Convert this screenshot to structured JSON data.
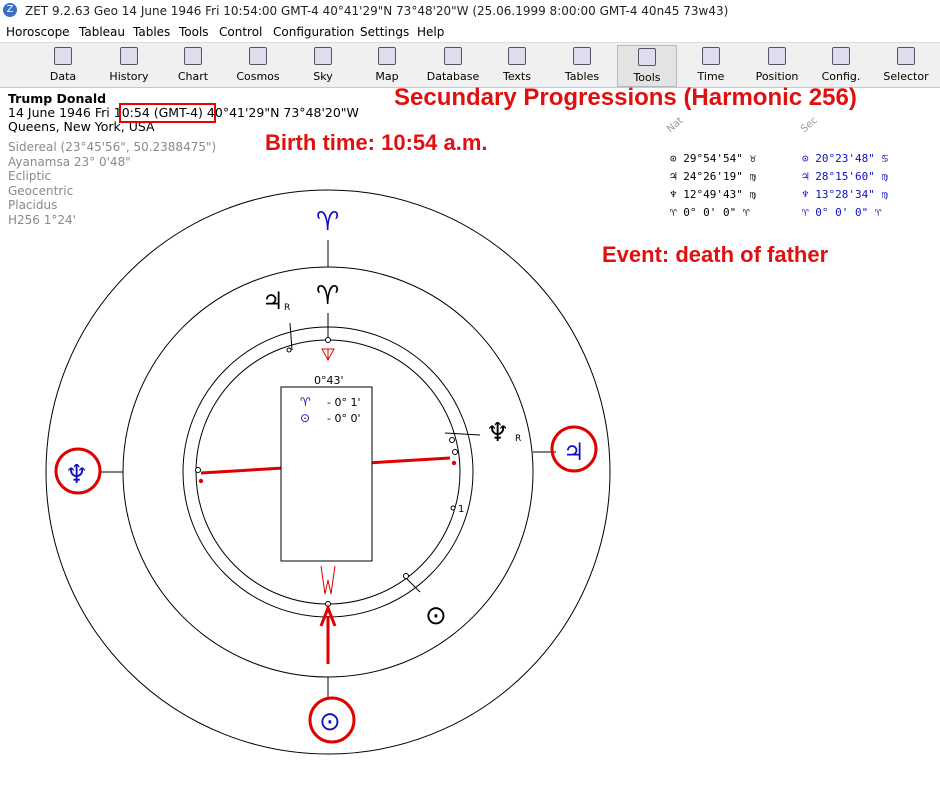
{
  "window": {
    "title": "ZET 9.2.63 Geo   14 June 1946  Fri  10:54:00 GMT-4 40°41'29\"N  73°48'20\"W  (25.06.1999   8:00:00 GMT-4 40n45 73w43)"
  },
  "menu": [
    "Horoscope",
    "Tableau",
    "Tables",
    "Tools",
    "Control",
    "Configuration",
    "Settings",
    "Help"
  ],
  "toolbar": [
    "Data",
    "History",
    "Chart",
    "Cosmos",
    "Sky",
    "Map",
    "Database",
    "Texts",
    "Tables",
    "Tools",
    "Time",
    "Position",
    "Config.",
    "Selector"
  ],
  "person": {
    "name": "Trump Donald",
    "date": "14 June 1946  Fri",
    "time": "10:54 (GMT-4)",
    "coords": "40°41'29\"N  73°48'20\"W",
    "place": "Queens, New York, USA"
  },
  "settings": [
    "Sidereal (23°45'56\", 50.2388475\")",
    "Ayanamsa 23° 0'48\"",
    "Ecliptic",
    "Geocentric",
    "Placidus",
    "H256   1°24'"
  ],
  "annotations": {
    "title": "Secundary Progressions (Harmonic 256)",
    "birth": "Birth time: 10:54  a.m.",
    "event": "Event: death of father"
  },
  "table": {
    "nat_header": "Nat",
    "sec_header": "Sec",
    "nat": [
      {
        "glyph": "⊙",
        "value": "29°54'54\" ♉"
      },
      {
        "glyph": "♃",
        "value": "24°26'19\" ♍"
      },
      {
        "glyph": "♆",
        "value": "12°49'43\" ♍"
      },
      {
        "glyph": "♈",
        "value": " 0° 0' 0\" ♈"
      }
    ],
    "sec": [
      {
        "glyph": "⊙",
        "value": "20°23'48\" ♋"
      },
      {
        "glyph": "♃",
        "value": "28°15'60\" ♍"
      },
      {
        "glyph": "♆",
        "value": "13°28'34\" ♍"
      },
      {
        "glyph": "♈",
        "value": " 0° 0' 0\" ♈"
      }
    ]
  },
  "chart": {
    "inner_label": "0°43'",
    "box_rows": [
      {
        "glyph": "♈",
        "value": "- 0° 1'"
      },
      {
        "glyph": "⊙",
        "value": "- 0° 0'"
      }
    ],
    "inner_glyphs": {
      "jupiter": "♃",
      "retro": "R",
      "aries": "♈",
      "neptune": "♆",
      "sun": "⊙",
      "jup_label": "♃",
      "numeral_one": "1"
    },
    "outer_glyphs": {
      "aries": "♈",
      "neptune": "♆",
      "jupiter": "♃",
      "sun": "⊙"
    }
  },
  "colors": {
    "annotation": "#e01010",
    "blue": "#1010c0",
    "red": "#e00000"
  }
}
